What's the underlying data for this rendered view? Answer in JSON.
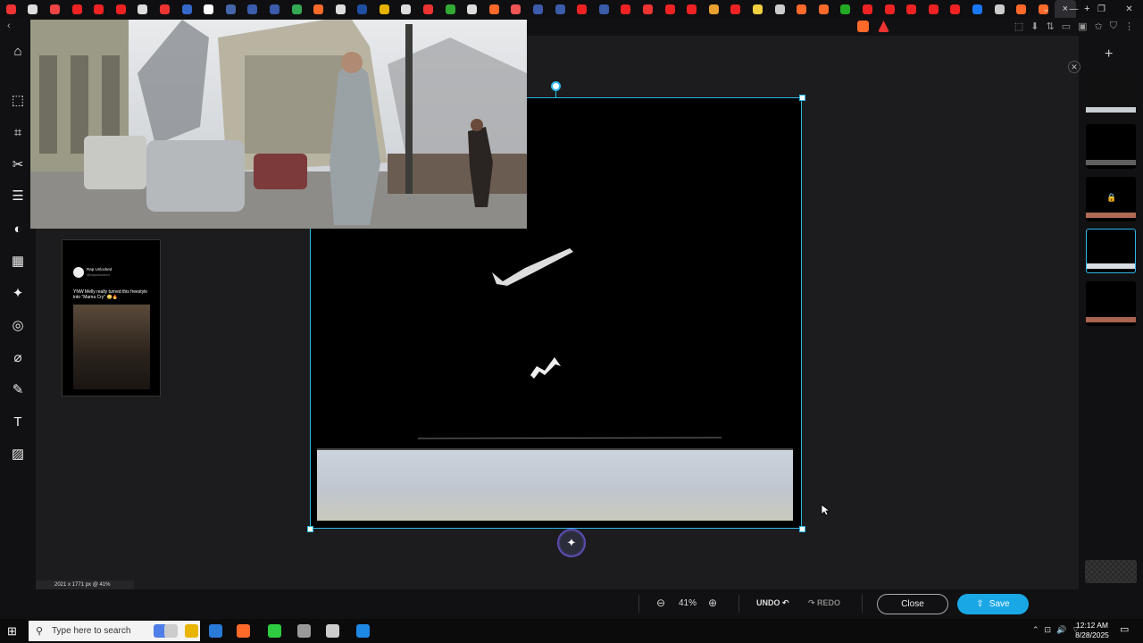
{
  "browser": {
    "tab_icon_colors": [
      "#e33",
      "#ddd",
      "#e44",
      "#e22",
      "#e22",
      "#e22",
      "#ddd",
      "#e33",
      "#3467c8",
      "#fff",
      "#46a",
      "#3b5bab",
      "#3b5bab",
      "#34a853",
      "#ff6a2b",
      "#ddd",
      "#1e4fa0",
      "#e6b400",
      "#ddd",
      "#e33",
      "#3a3",
      "#ddd",
      "#ff6a2b",
      "#e55",
      "#3b5bab",
      "#3b5bab",
      "#e22",
      "#3b5bab",
      "#e22",
      "#e33",
      "#e22",
      "#e22",
      "#e8a030",
      "#e22",
      "#f0d040",
      "#ccc",
      "#ff6a2b",
      "#ff6a2b",
      "#2a2",
      "#e22",
      "#e22",
      "#e22",
      "#e22",
      "#e22",
      "#1877f2",
      "#ccc",
      "#ff6a2b",
      "#ff6a2b"
    ],
    "active_tab_close": "×",
    "new_tab": "+",
    "window_controls": [
      "⌄",
      "—",
      "❐",
      "✕"
    ]
  },
  "toolbar": {
    "back": "‹",
    "right_icons": [
      "⬚",
      "⬇",
      "⇅",
      "▭",
      "▣",
      "✩",
      "⛉",
      "⋮"
    ]
  },
  "tools": [
    {
      "name": "select-tool-icon",
      "glyph": "⬚"
    },
    {
      "name": "crop-tool-icon",
      "glyph": "⌗"
    },
    {
      "name": "cut-tool-icon",
      "glyph": "✂"
    },
    {
      "name": "adjust-tool-icon",
      "glyph": "☰"
    },
    {
      "name": "filter-tool-icon",
      "glyph": "◐"
    },
    {
      "name": "effects-tool-icon",
      "glyph": "▦"
    },
    {
      "name": "magic-tool-icon",
      "glyph": "✦"
    },
    {
      "name": "spiral-tool-icon",
      "glyph": "◎"
    },
    {
      "name": "bandage-tool-icon",
      "glyph": "⌀"
    },
    {
      "name": "brush-tool-icon",
      "glyph": "✎"
    },
    {
      "name": "text-tool-icon",
      "glyph": "T"
    },
    {
      "name": "pattern-tool-icon",
      "glyph": "▨"
    }
  ],
  "home_icon": "⌂",
  "tweet": {
    "name": "Rap Unlocked",
    "handle": "@rapunlocked",
    "text": "YNW Melly really turned this freestyle into \"Mama Cry\" 😳🔥"
  },
  "layers": {
    "add": "+",
    "close": "✕",
    "lock": "🔒",
    "strip_colors": [
      "#c9ced3",
      "#606060",
      "#b06a55",
      "#d8dde2",
      "#a8644e"
    ]
  },
  "status": {
    "dimensions": "2021 x 1771 px @ 41%"
  },
  "bottombar": {
    "zoom_out": "⊖",
    "zoom": "41%",
    "zoom_in": "⊕",
    "undo": "UNDO ↶",
    "redo": "↷ REDO",
    "close": "Close",
    "save": "Save",
    "save_icon": "⇪"
  },
  "magic_button": "✦",
  "taskbar": {
    "start": "⊞",
    "search_icon": "⚲",
    "search_placeholder": "Type here to search",
    "app_colors": [
      "#4f7ee8",
      "#ccc",
      "#e8b500",
      "#2a7ad8",
      "#ff6a2b",
      "#2ecc40",
      "#999",
      "#ccc",
      "#1e88e5"
    ],
    "tray": [
      "⌃",
      "⊡",
      "🔊",
      "⌔"
    ],
    "time": "12:12 AM",
    "date": "8/28/2025",
    "notifications": "▭"
  }
}
